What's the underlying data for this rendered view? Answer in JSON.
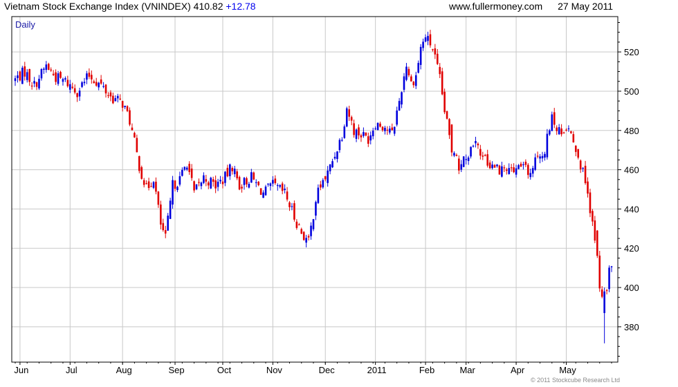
{
  "header": {
    "title": "Vietnam Stock Exchange Index (VNINDEX)",
    "last": "410.82",
    "change": "+12.78",
    "source": "www.fullermoney.com",
    "date": "27 May 2011"
  },
  "footer": {
    "copyright": "© 2011 Stockcube Research Ltd"
  },
  "colors": {
    "up": "#0000dd",
    "down": "#e00000",
    "grid": "#c8c8c8",
    "axis": "#000000",
    "period_label": "#1a1aa6"
  },
  "chart_data": {
    "type": "candlestick",
    "period_label": "Daily",
    "y_axis_side": "right",
    "ylim": [
      362,
      538
    ],
    "yticks": [
      380,
      400,
      420,
      440,
      460,
      480,
      500,
      520
    ],
    "xlim": [
      0,
      250
    ],
    "x_ticks": [
      {
        "label": "Jun",
        "x": 2
      },
      {
        "label": "Jul",
        "x": 23
      },
      {
        "label": "Aug",
        "x": 45
      },
      {
        "label": "Sep",
        "x": 67
      },
      {
        "label": "Oct",
        "x": 87
      },
      {
        "label": "Nov",
        "x": 108
      },
      {
        "label": "Dec",
        "x": 130
      },
      {
        "label": "2011",
        "x": 151
      },
      {
        "label": "Feb",
        "x": 172
      },
      {
        "label": "Mar",
        "x": 189
      },
      {
        "label": "Apr",
        "x": 210
      },
      {
        "label": "May",
        "x": 231
      }
    ],
    "grid": true,
    "close_anchors": [
      [
        0,
        506
      ],
      [
        4,
        510
      ],
      [
        8,
        503
      ],
      [
        13,
        513
      ],
      [
        17,
        507
      ],
      [
        21,
        505
      ],
      [
        26,
        500
      ],
      [
        31,
        508
      ],
      [
        36,
        503
      ],
      [
        40,
        497
      ],
      [
        45,
        494
      ],
      [
        48,
        485
      ],
      [
        52,
        462
      ],
      [
        55,
        450
      ],
      [
        58,
        456
      ],
      [
        61,
        432
      ],
      [
        63,
        425
      ],
      [
        66,
        452
      ],
      [
        69,
        455
      ],
      [
        72,
        464
      ],
      [
        75,
        448
      ],
      [
        79,
        456
      ],
      [
        84,
        452
      ],
      [
        88,
        456
      ],
      [
        91,
        462
      ],
      [
        94,
        452
      ],
      [
        99,
        456
      ],
      [
        104,
        448
      ],
      [
        108,
        452
      ],
      [
        113,
        448
      ],
      [
        117,
        436
      ],
      [
        120,
        428
      ],
      [
        123,
        423
      ],
      [
        126,
        445
      ],
      [
        128,
        452
      ],
      [
        131,
        458
      ],
      [
        134,
        468
      ],
      [
        137,
        478
      ],
      [
        139,
        492
      ],
      [
        142,
        480
      ],
      [
        145,
        478
      ],
      [
        148,
        476
      ],
      [
        151,
        484
      ],
      [
        155,
        482
      ],
      [
        158,
        478
      ],
      [
        161,
        495
      ],
      [
        164,
        514
      ],
      [
        166,
        504
      ],
      [
        168,
        508
      ],
      [
        170,
        522
      ],
      [
        172,
        528
      ],
      [
        175,
        522
      ],
      [
        178,
        506
      ],
      [
        180,
        490
      ],
      [
        183,
        470
      ],
      [
        186,
        462
      ],
      [
        190,
        468
      ],
      [
        193,
        472
      ],
      [
        196,
        466
      ],
      [
        200,
        462
      ],
      [
        204,
        460
      ],
      [
        208,
        458
      ],
      [
        212,
        462
      ],
      [
        216,
        458
      ],
      [
        219,
        466
      ],
      [
        222,
        470
      ],
      [
        225,
        486
      ],
      [
        227,
        480
      ],
      [
        230,
        478
      ],
      [
        232,
        482
      ],
      [
        234,
        476
      ],
      [
        236,
        468
      ],
      [
        238,
        458
      ],
      [
        240,
        448
      ],
      [
        242,
        432
      ],
      [
        244,
        414
      ],
      [
        245,
        402
      ],
      [
        246,
        393
      ],
      [
        247,
        389
      ],
      [
        248,
        398
      ],
      [
        249,
        410.82
      ]
    ],
    "drops": [
      [
        183,
        483
      ],
      [
        244,
        429
      ],
      [
        246,
        399
      ]
    ],
    "y_unit": "index points"
  }
}
